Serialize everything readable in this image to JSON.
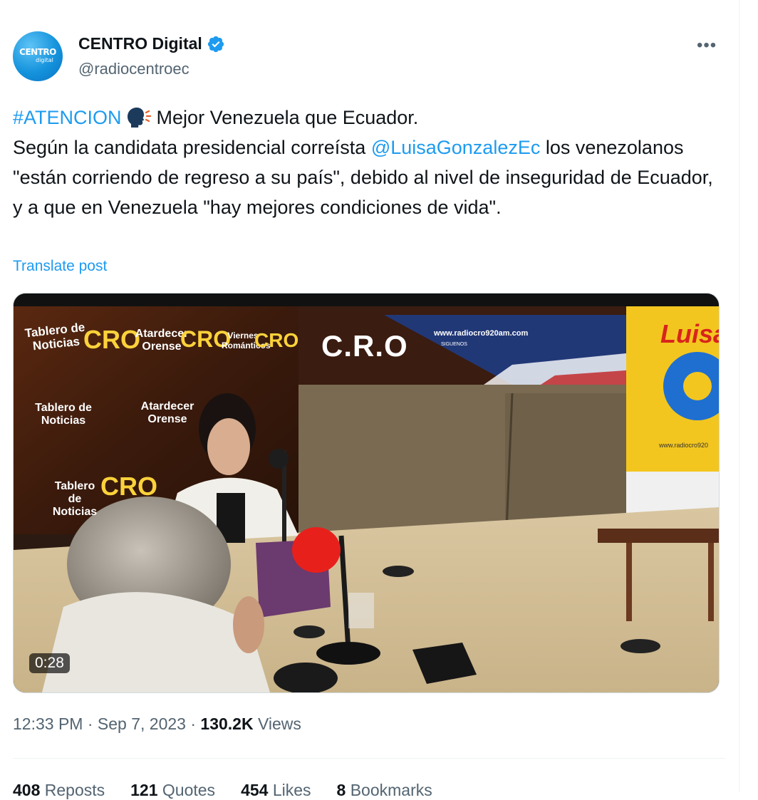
{
  "author": {
    "display_name": "CENTRO Digital",
    "handle": "@radiocentroec",
    "avatar_text": "CENTRO",
    "avatar_subtext": "digital",
    "verified_icon": "verified-badge-icon",
    "more_icon": "more-options-icon",
    "more_label": "•••"
  },
  "tweet": {
    "hashtag": "#ATENCION",
    "emoji": "speaking-head-icon",
    "line1_rest": " Mejor Venezuela que Ecuador.",
    "line2_pre": "Según la candidata presidencial correísta ",
    "mention": "@LuisaGonzalezEc",
    "body_rest": " los venezolanos \"están corriendo de regreso a su país\", debido al nivel de inseguridad de Ecuador, y a que en Venezuela \"hay mejores condiciones de vida\".",
    "translate_label": "Translate post"
  },
  "media": {
    "duration": "0:28",
    "wall_texts": [
      "Tablero de Noticias",
      "CRO",
      "Atardecer Orense",
      "Viernes Románticos"
    ],
    "banner_brand": "C.R.O",
    "banner_url": "www.radiocro920am.com",
    "banner_follow": "SIGUENOS",
    "side_banner_name": "Luisa",
    "side_banner_url": "www.radiocro920"
  },
  "meta": {
    "time": "12:33 PM",
    "separator": " · ",
    "date": "Sep 7, 2023",
    "views_count": "130.2K",
    "views_label": " Views"
  },
  "stats": {
    "reposts_count": "408",
    "reposts_label": " Reposts",
    "quotes_count": "121",
    "quotes_label": " Quotes",
    "likes_count": "454",
    "likes_label": " Likes",
    "bookmarks_count": "8",
    "bookmarks_label": " Bookmarks"
  },
  "colors": {
    "accent": "#1d9bf0",
    "secondary_text": "#536471",
    "primary_text": "#0f1419",
    "mic_red": "#e8201c"
  }
}
